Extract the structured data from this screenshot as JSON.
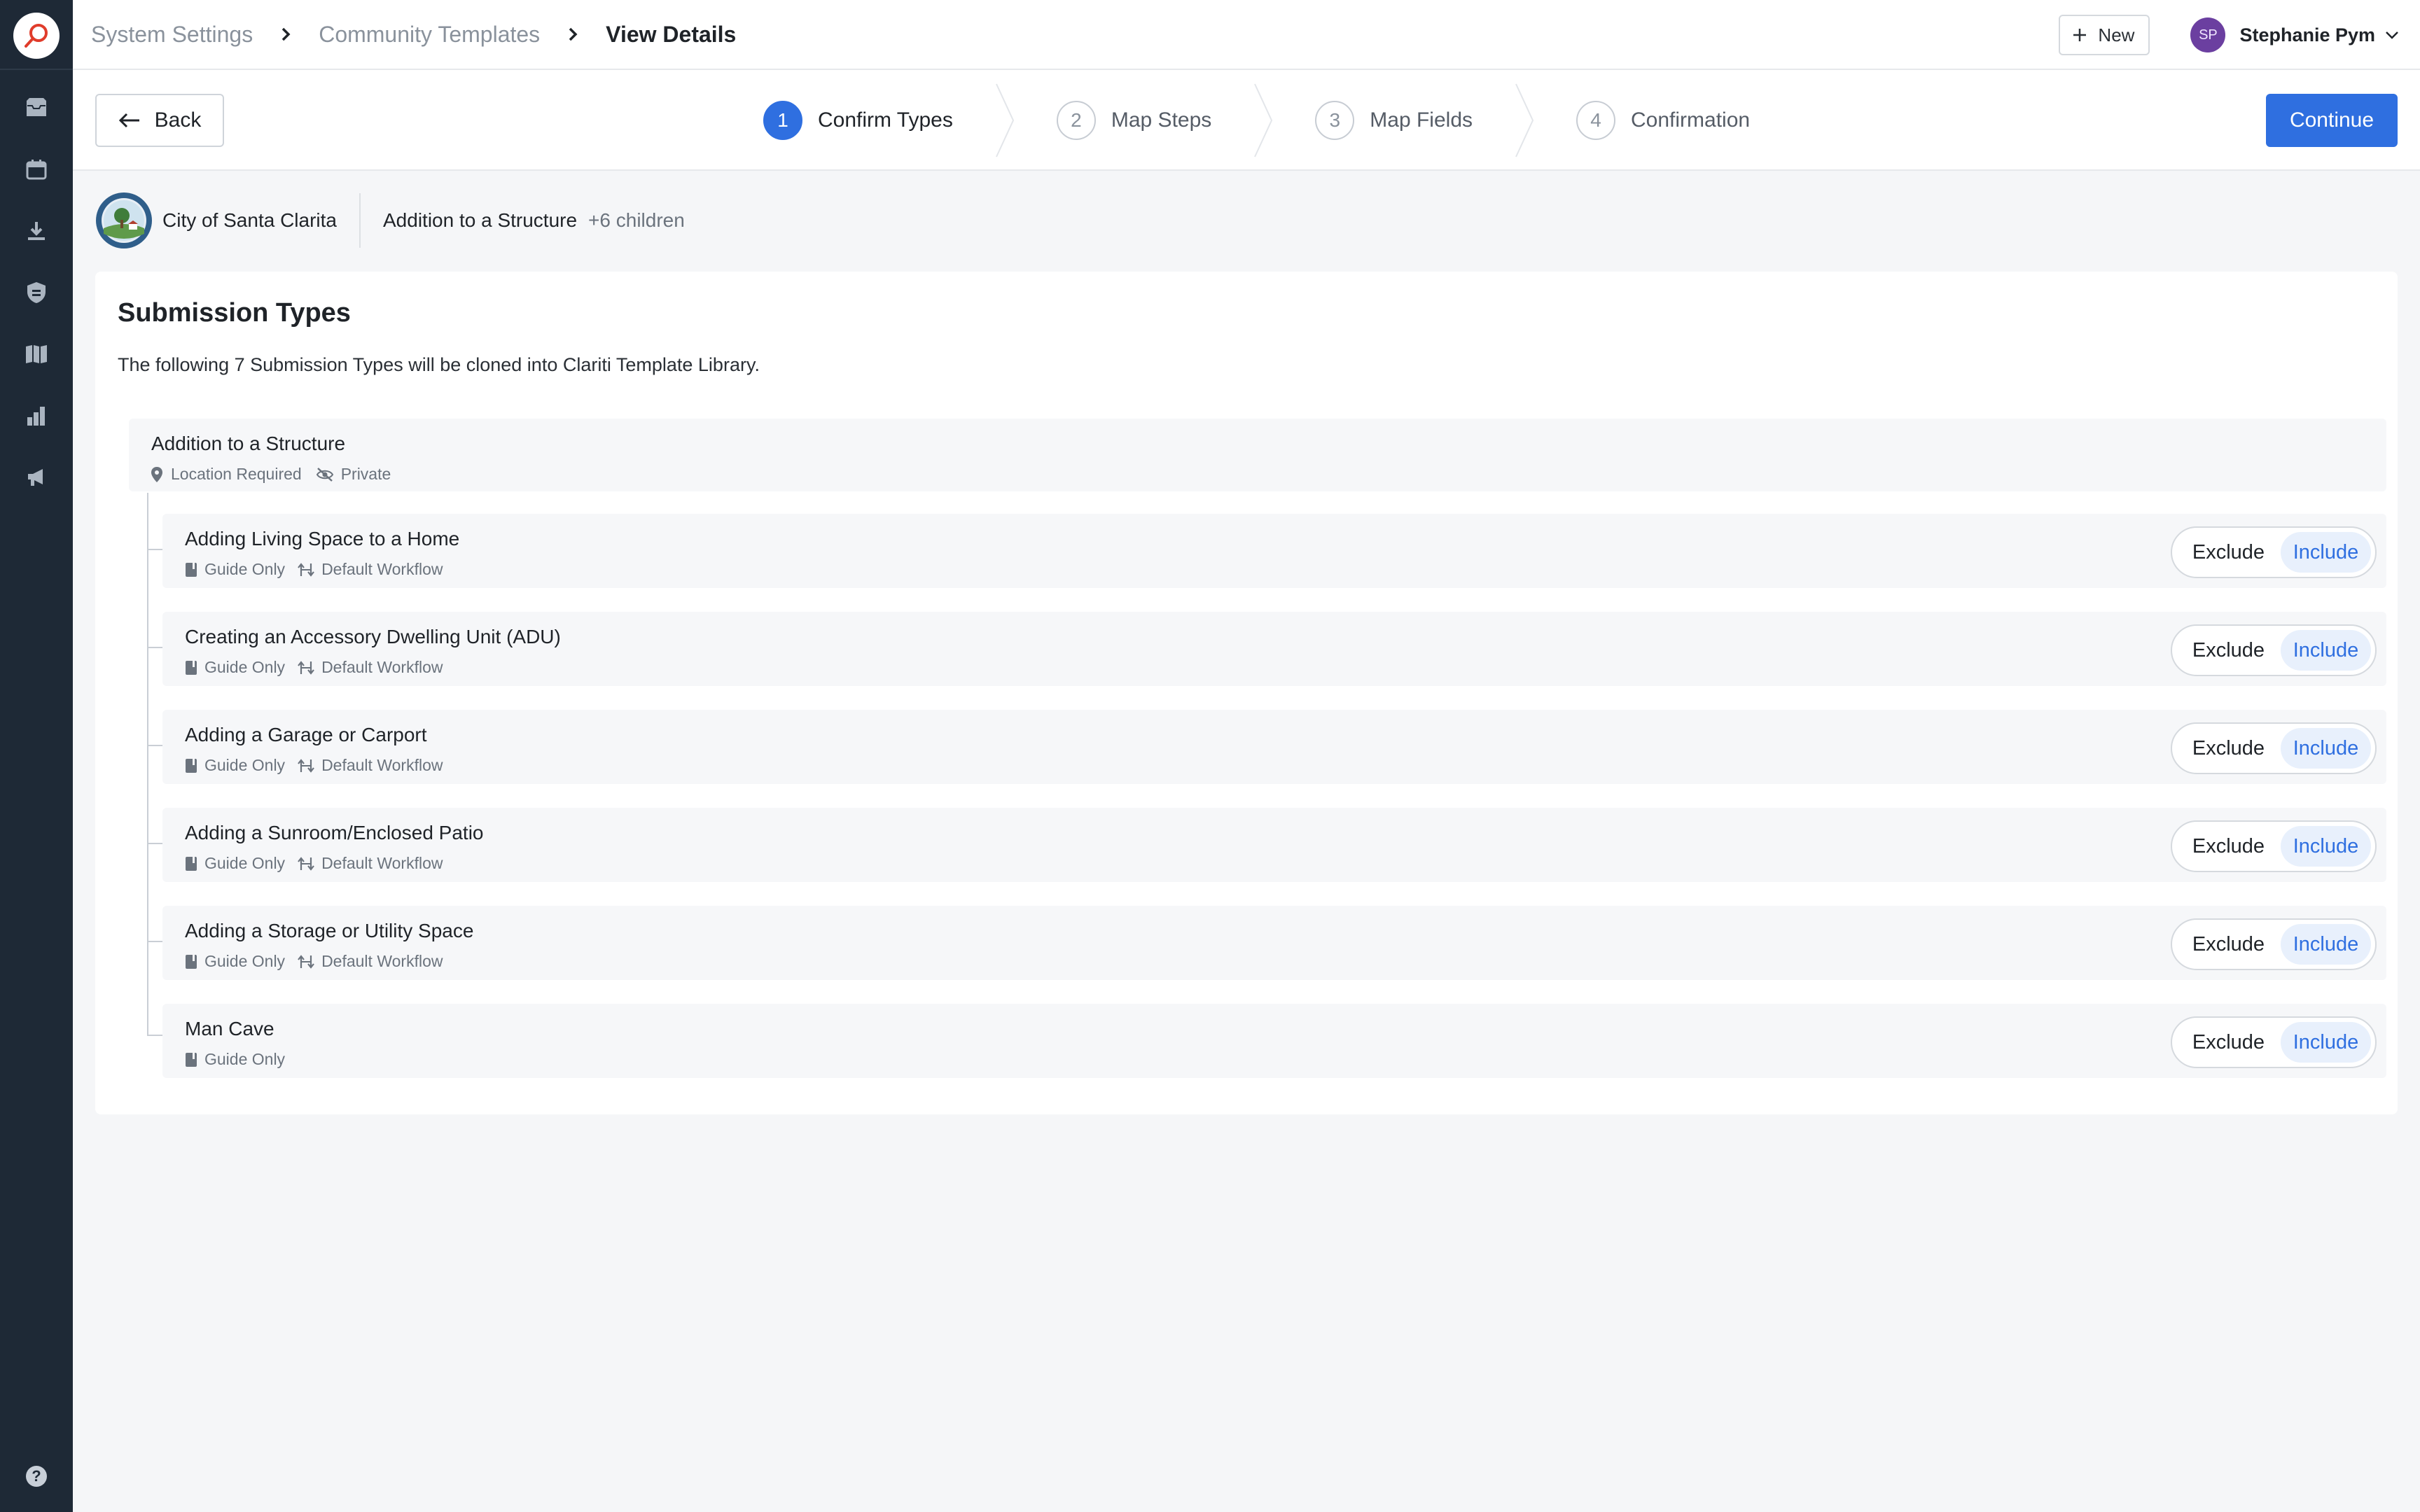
{
  "breadcrumb": {
    "items": [
      "System Settings",
      "Community Templates"
    ],
    "current": "View Details"
  },
  "header": {
    "new_label": "New",
    "user_initials": "SP",
    "user_name": "Stephanie Pym"
  },
  "stepper": {
    "back_label": "Back",
    "continue_label": "Continue",
    "steps": [
      {
        "number": "1",
        "label": "Confirm Types",
        "active": true
      },
      {
        "number": "2",
        "label": "Map Steps",
        "active": false
      },
      {
        "number": "3",
        "label": "Map Fields",
        "active": false
      },
      {
        "number": "4",
        "label": "Confirmation",
        "active": false
      }
    ]
  },
  "context": {
    "org_name": "City of Santa Clarita",
    "template_title": "Addition to a Structure",
    "children_count": "+6 children"
  },
  "card": {
    "title": "Submission Types",
    "description": "The following 7 Submission Types will be cloned into Clariti Template Library."
  },
  "parent_type": {
    "title": "Addition to a Structure",
    "meta": [
      "Location Required",
      "Private"
    ]
  },
  "toggle_labels": {
    "exclude": "Exclude",
    "include": "Include"
  },
  "child_types": [
    {
      "title": "Adding Living Space to a Home",
      "guide": "Guide Only",
      "workflow": "Default Workflow",
      "selected": "Include"
    },
    {
      "title": "Creating an Accessory Dwelling Unit (ADU)",
      "guide": "Guide Only",
      "workflow": "Default Workflow",
      "selected": "Include"
    },
    {
      "title": "Adding a Garage or Carport",
      "guide": "Guide Only",
      "workflow": "Default Workflow",
      "selected": "Include"
    },
    {
      "title": "Adding a Sunroom/Enclosed Patio",
      "guide": "Guide Only",
      "workflow": "Default Workflow",
      "selected": "Include"
    },
    {
      "title": "Adding a Storage or Utility Space",
      "guide": "Guide Only",
      "workflow": "Default Workflow",
      "selected": "Include"
    },
    {
      "title": "Man Cave",
      "guide": "Guide Only",
      "workflow": "",
      "selected": "Include"
    }
  ],
  "colors": {
    "accent": "#2f6fe0",
    "rail": "#1e2936",
    "include_bg": "#e8f0fc"
  },
  "icons": {
    "rail": [
      "inbox-icon",
      "calendar-icon",
      "download-icon",
      "shield-icon",
      "map-icon",
      "bar-chart-icon",
      "megaphone-icon"
    ],
    "help": "help-icon"
  }
}
